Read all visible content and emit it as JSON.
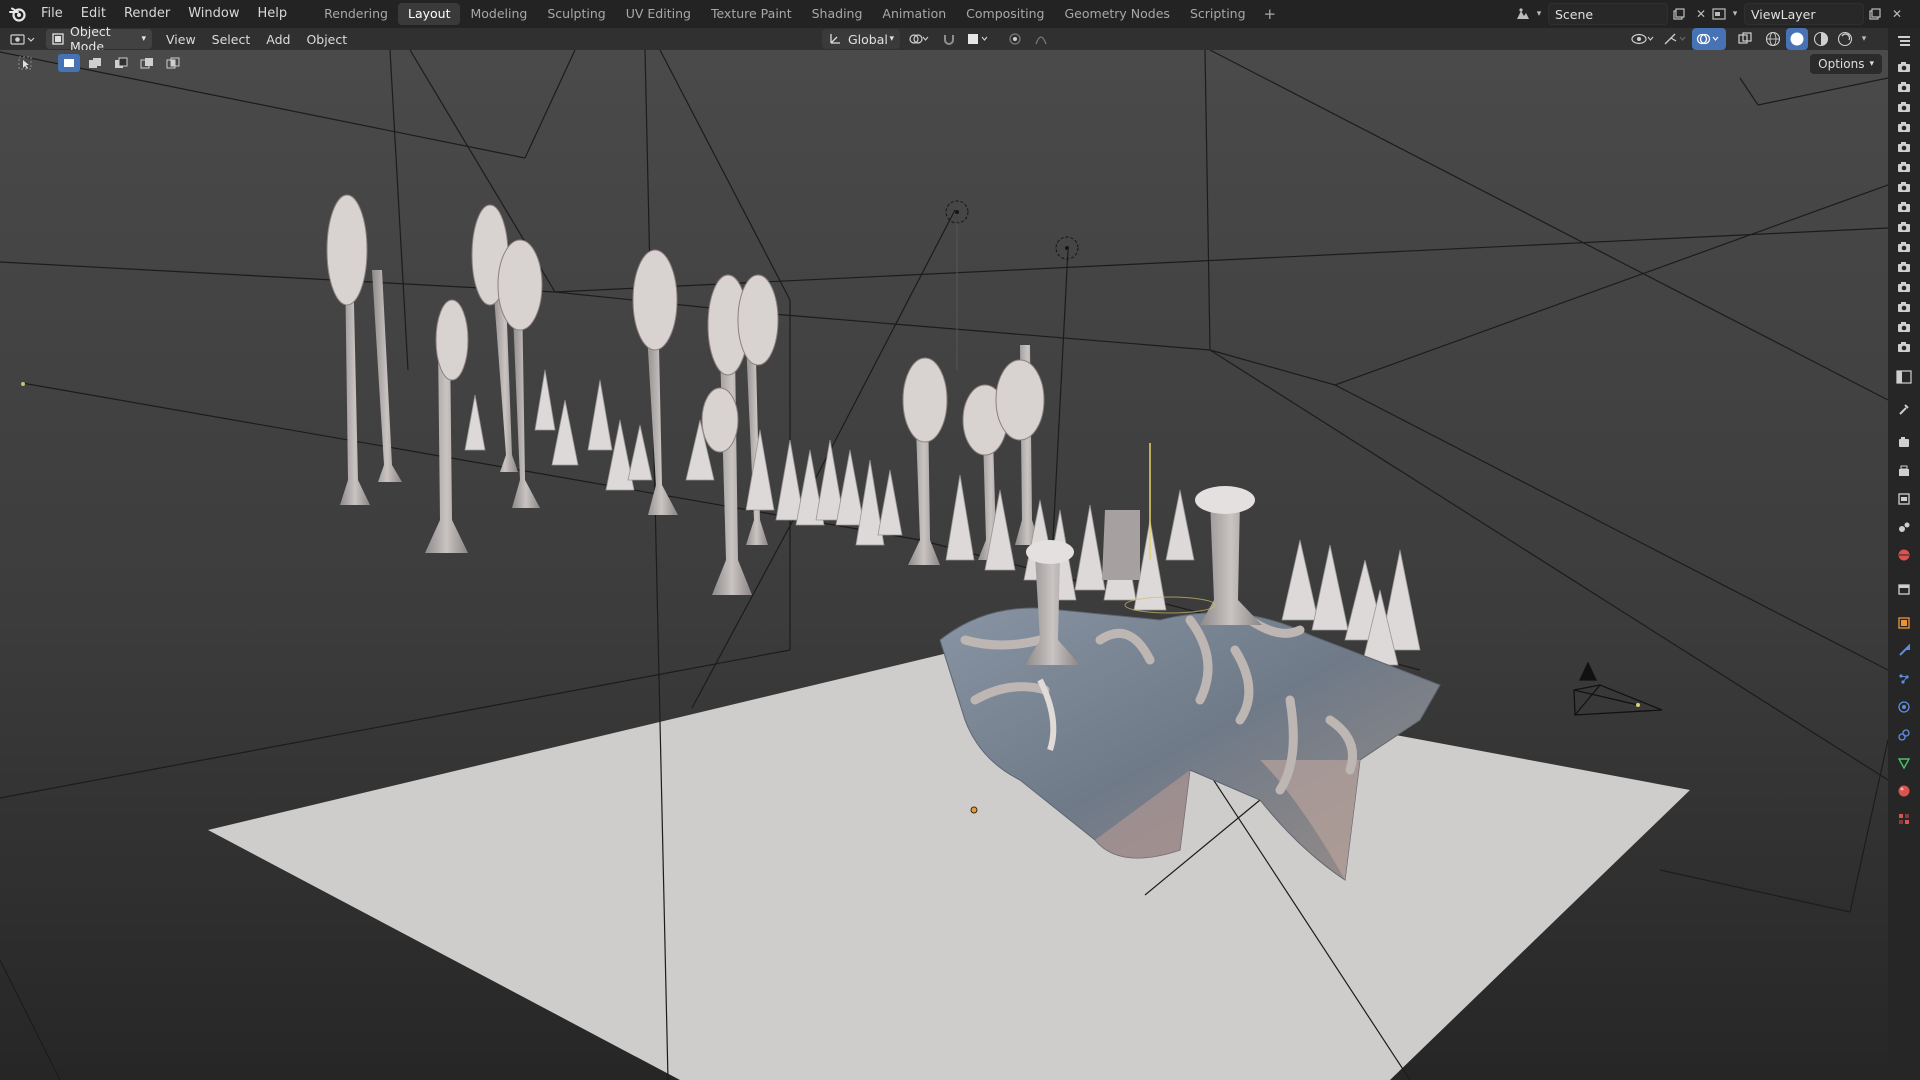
{
  "topbar": {
    "menus": [
      "File",
      "Edit",
      "Render",
      "Window",
      "Help"
    ],
    "workspaces": [
      "Rendering",
      "Layout",
      "Modeling",
      "Sculpting",
      "UV Editing",
      "Texture Paint",
      "Shading",
      "Animation",
      "Compositing",
      "Geometry Nodes",
      "Scripting"
    ],
    "active_workspace": "Layout",
    "add_workspace": "+",
    "scene_name": "Scene",
    "view_layer_name": "ViewLayer"
  },
  "viewport_header": {
    "mode": "Object Mode",
    "menus": [
      "View",
      "Select",
      "Add",
      "Object"
    ],
    "orientation": "Global"
  },
  "viewport": {
    "options_label": "Options",
    "world_bg_top": "#4a4a4a",
    "world_bg_bottom": "#262626",
    "floor_color": "#cfcdcb"
  },
  "properties_tabs": [
    "tool-icon",
    "render-icon",
    "output-icon",
    "view-layer-icon",
    "scene-icon",
    "world-icon",
    "collection-icon",
    "object-icon",
    "modifier-icon",
    "particles-icon",
    "physics-icon",
    "constraints-icon",
    "data-icon",
    "material-icon",
    "texture-icon"
  ],
  "colors": {
    "accent_blue": "#4772b3",
    "tab_active": "#3a3a3a",
    "header_bg": "#303030",
    "topbar_bg": "#232323"
  }
}
